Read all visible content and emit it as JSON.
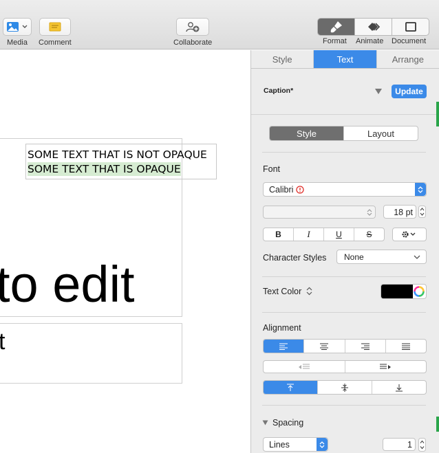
{
  "toolbar": {
    "media_label": "Media",
    "comment_label": "Comment",
    "collaborate_label": "Collaborate",
    "format_label": "Format",
    "animate_label": "Animate",
    "document_label": "Document"
  },
  "canvas": {
    "line1": "SOME TEXT THAT IS NOT OPAQUE",
    "line2": "SOME TEXT THAT IS OPAQUE",
    "big_text": "to edit",
    "small_text": "t",
    "highlight_color": "#d6ecd2"
  },
  "inspector": {
    "tabs": [
      "Style",
      "Text",
      "Arrange"
    ],
    "active_tab": "Text",
    "paragraph_style": "Caption*",
    "update_label": "Update",
    "sub_tabs": [
      "Style",
      "Layout"
    ],
    "font_section": "Font",
    "font_name": "Calibri",
    "font_size": "18 pt",
    "bold": "B",
    "italic": "I",
    "underline": "U",
    "strike": "S",
    "char_styles_label": "Character Styles",
    "char_styles_value": "None",
    "text_color_label": "Text Color",
    "text_color": "#000000",
    "alignment_label": "Alignment",
    "spacing_label": "Spacing",
    "spacing_mode": "Lines",
    "spacing_value": "1",
    "accent_color": "#3b8ae8"
  }
}
